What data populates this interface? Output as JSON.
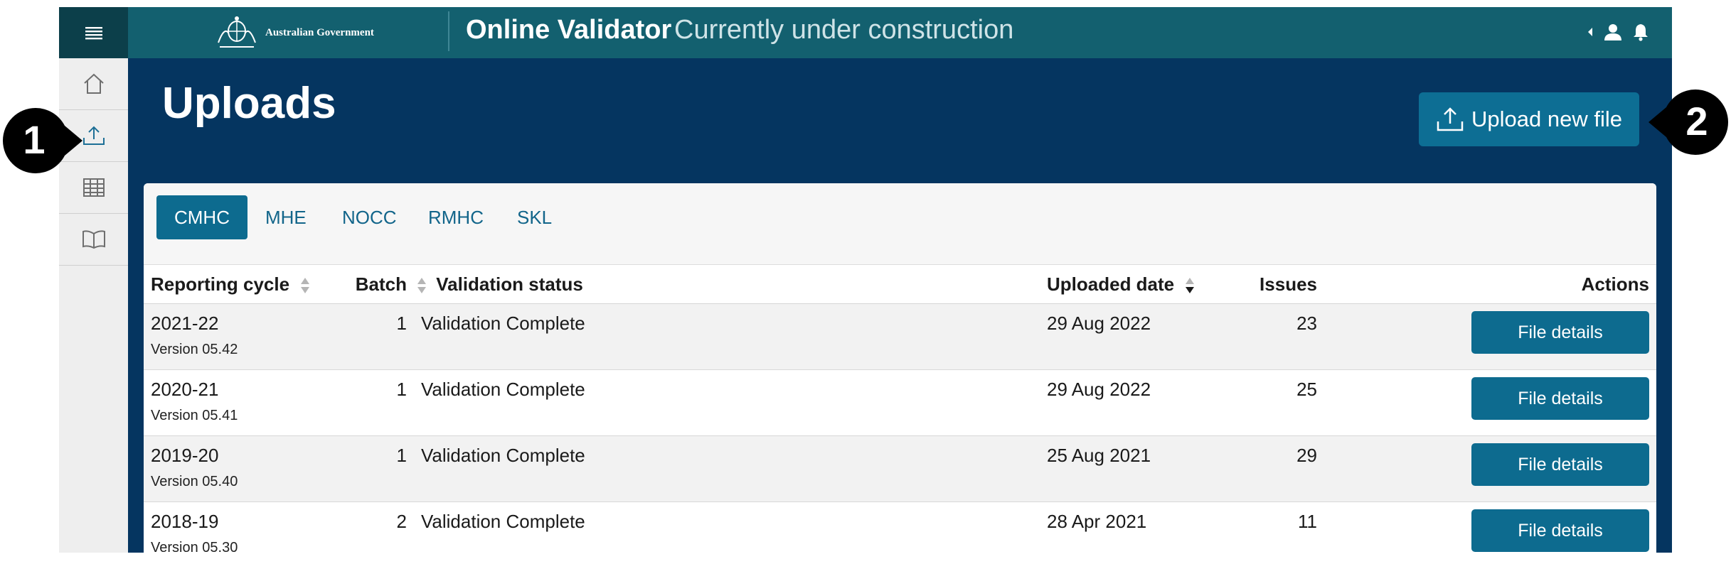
{
  "header": {
    "gov_label": "Australian Government",
    "app_title": "Online Validator",
    "app_subtitle": "Currently under construction"
  },
  "sidebar": {
    "items": [
      {
        "icon": "home-icon"
      },
      {
        "icon": "upload-icon",
        "active": true
      },
      {
        "icon": "table-icon"
      },
      {
        "icon": "book-icon"
      }
    ]
  },
  "page": {
    "title": "Uploads",
    "upload_button": "Upload new file"
  },
  "tabs": [
    "CMHC",
    "MHE",
    "NOCC",
    "RMHC",
    "SKL"
  ],
  "table": {
    "columns": {
      "reporting_cycle": "Reporting cycle",
      "batch": "Batch",
      "validation_status": "Validation status",
      "uploaded_date": "Uploaded date",
      "issues": "Issues",
      "actions": "Actions"
    },
    "rows": [
      {
        "cycle": "2021-22",
        "version": "Version 05.42",
        "batch": "1",
        "status": "Validation Complete",
        "date": "29 Aug 2022",
        "issues": "23",
        "action": "File details"
      },
      {
        "cycle": "2020-21",
        "version": "Version 05.41",
        "batch": "1",
        "status": "Validation Complete",
        "date": "29 Aug 2022",
        "issues": "25",
        "action": "File details"
      },
      {
        "cycle": "2019-20",
        "version": "Version 05.40",
        "batch": "1",
        "status": "Validation Complete",
        "date": "25 Aug 2021",
        "issues": "29",
        "action": "File details"
      },
      {
        "cycle": "2018-19",
        "version": "Version 05.30",
        "batch": "2",
        "status": "Validation Complete",
        "date": "28 Apr 2021",
        "issues": "11",
        "action": "File details"
      }
    ]
  },
  "callouts": [
    "1",
    "2"
  ],
  "colors": {
    "topbar": "#13606f",
    "band": "#053560",
    "accent": "#0d6b8f"
  }
}
